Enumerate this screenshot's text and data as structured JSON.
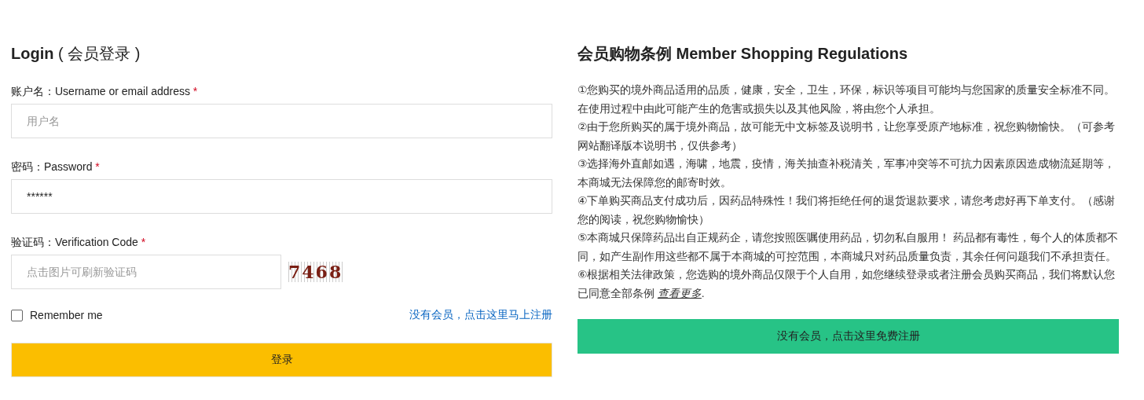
{
  "login": {
    "title": "Login",
    "title_suffix": "( 会员登录 )",
    "fields": [
      {
        "label": "账户名：Username or email address",
        "required": "*",
        "placeholder": "用户名",
        "kind": "text"
      },
      {
        "label": "密码：Password",
        "required": "*",
        "value": "******",
        "kind": "text"
      },
      {
        "label": "验证码：Verification Code",
        "required": "*",
        "placeholder": "点击图片可刷新验证码",
        "kind": "captcha",
        "captcha": "7468"
      }
    ],
    "remember": {
      "label": "Remember me",
      "checked": false
    },
    "register_link": "没有会员，点击这里马上注册",
    "submit": "登录"
  },
  "regulations": {
    "title": "会员购物条例 Member Shopping Regulations",
    "items": [
      {
        "text": "①您购买的境外商品适用的品质，健康，安全，卫生，环保，标识等项目可能均与您国家的质量安全标准不同。在使用过程中由此可能产生的危害或损失以及其他风险，将由您个人承担。"
      },
      {
        "text": "②由于您所购买的属于境外商品，故可能无中文标签及说明书，让您享受原产地标准，祝您购物愉快。（可参考网站翻译版本说明书，仅供参考）"
      },
      {
        "text": "③选择海外直邮如遇，海啸，地震，疫情，海关抽查补税清关，军事冲突等不可抗力因素原因造成物流延期等，本商城无法保障您的邮寄时效。"
      },
      {
        "text": "④下单购买商品支付成功后，因药品特殊性！我们将拒绝任何的退货退款要求，请您考虑好再下单支付。（感谢您的阅读，祝您购物愉快）"
      },
      {
        "text": "⑤本商城只保障药品出自正规药企，请您按照医嘱使用药品，切勿私自服用！ 药品都有毒性，每个人的体质都不同，如产生副作用这些都不属于本商城的可控范围，本商城只对药品质量负责，其余任何问题我们不承担责任。"
      },
      {
        "text": "⑥根据相关法律政策，您选购的境外商品仅限于个人自用，如您继续登录或者注册会员购买商品，我们将默认您已同意全部条例 ",
        "link": "查看更多",
        "after": "."
      }
    ],
    "register_button": "没有会员，点击这里免费注册"
  }
}
